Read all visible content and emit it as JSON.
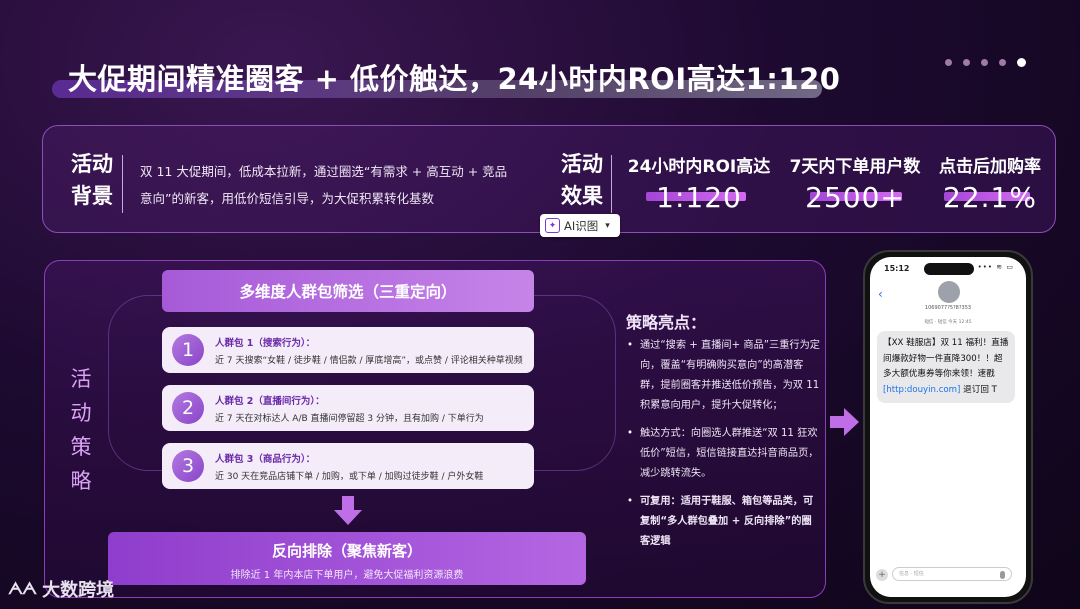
{
  "title": "大促期间精准圈客 + 低价触达，24小时内ROI高达1:120",
  "background_section": {
    "label": "活动背景",
    "description": "双 11 大促期间，低成本拉新，通过圈选“有需求 + 高互动 + 竞品意向”的新客，用低价短信引导，为大促积累转化基数"
  },
  "effect_section": {
    "label": "活动效果",
    "metrics": [
      {
        "label": "24小时内ROI高达",
        "value": "1:120"
      },
      {
        "label": "7天内下单用户数",
        "value": "2500+"
      },
      {
        "label": "点击后加购率",
        "value": "22.1%"
      }
    ]
  },
  "ai_button": {
    "label": "AI识图",
    "icon": "ai-scan-icon"
  },
  "strategy_section": {
    "label": "活动策略",
    "filter_header": "多维度人群包筛选（三重定向）",
    "packs": [
      {
        "num": "1",
        "title": "人群包 1（搜索行为）：",
        "desc": "近 7 天搜索“女鞋 / 徒步鞋 / 情侣款 / 厚底增高”，或点赞 / 评论相关种草视频"
      },
      {
        "num": "2",
        "title": "人群包 2（直播间行为）：",
        "desc": "近 7 天在对标达人 A/B 直播间停留超 3 分钟，且有加购 / 下单行为"
      },
      {
        "num": "3",
        "title": "人群包 3（商品行为）：",
        "desc": "近 30 天在竞品店铺下单 / 加购，或下单 / 加购过徒步鞋 / 户外女鞋"
      }
    ],
    "exclusion": {
      "title": "反向排除（聚焦新客）",
      "subtitle": "排除近 1 年内本店下单用户，避免大促福利资源浪费"
    }
  },
  "highlights": {
    "title": "策略亮点：",
    "items": [
      {
        "lead": "",
        "text": "通过“搜索 + 直播间+ 商品”三重行为定向，覆盖“有明确购买意向”的高潜客群，提前圈客并推送低价预告，为双 11 积累意向用户，提升大促转化；"
      },
      {
        "lead": "",
        "text": "触达方式：向圈选人群推送“双 11 狂欢低价”短信，短信链接直达抖音商品页，减少跳转流失。"
      },
      {
        "lead": "可复用：",
        "text": "适用于鞋服、箱包等品类，可复制“多人群包叠加 + 反向排除”的圈客逻辑"
      }
    ]
  },
  "phone": {
    "time": "15:12",
    "status": "••• ≋ ▭",
    "number": "1069077?5?8?353",
    "sub": "短信 · 短信\n今天 12:45",
    "message_before": "【XX 鞋服店】双 11 福利！直播间爆款好物一件直降300！！超多大额优惠券等你来领！速戳",
    "link": "[http:douyin.com]",
    "message_after": " 退订回 T",
    "input_placeholder": "信息 · 短信"
  },
  "logo": {
    "mark": "ᗅᗅ",
    "text": "大数跨境"
  },
  "colors": {
    "accent": "#a446d6",
    "card_border": "#8a4fb8",
    "pack_bg": "#f4edf9"
  }
}
